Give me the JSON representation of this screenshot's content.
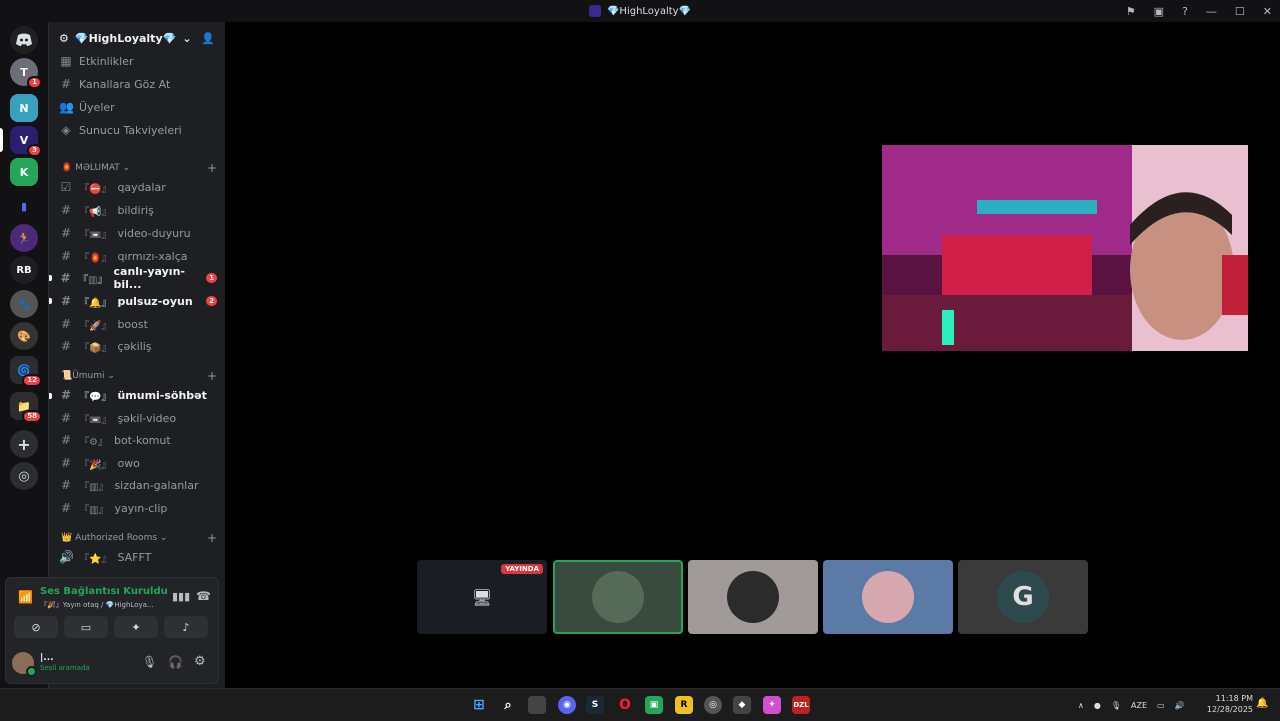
{
  "window": {
    "title": "💎HighLoyalty💎"
  },
  "guilds": {
    "items": [
      {
        "name": "discord-home-icon"
      },
      {
        "label": "T",
        "badge": "1"
      },
      {
        "label": "N"
      },
      {
        "label": "V",
        "badge": "3"
      },
      {
        "label": "K"
      },
      {
        "label": "▮"
      },
      {
        "label": "🏃"
      },
      {
        "label": "RB"
      },
      {
        "label": "🐾"
      },
      {
        "label": "🎨"
      },
      {
        "label": "🌀",
        "badge": "12"
      },
      {
        "label": "📁",
        "badge": "58"
      }
    ]
  },
  "server": {
    "name": "💎HighLoyalty💎",
    "chevron": "⌄",
    "menu": [
      {
        "icon": "calendar-icon",
        "label": "Etkinlikler"
      },
      {
        "icon": "browse-channels-icon",
        "label": "Kanallara Göz At"
      },
      {
        "icon": "members-icon",
        "label": "Üyeler"
      },
      {
        "icon": "boost-icon",
        "label": "Sunucu Takviyeleri"
      }
    ]
  },
  "categories": [
    {
      "label": "🏮 MƏLUMAT ⌄"
    },
    {
      "label": "📜Ümumi ⌄"
    },
    {
      "label": "👑 Authorized Rooms ⌄"
    }
  ],
  "channels": {
    "melumat": [
      {
        "prefix": "『⛔』",
        "name": "qaydalar",
        "icon": "☑"
      },
      {
        "prefix": "『📢』",
        "name": "bildiriş",
        "icon": "#"
      },
      {
        "prefix": "『📼』",
        "name": "video-duyuru",
        "icon": "#"
      },
      {
        "prefix": "『🏮』",
        "name": "qırmızı-xalça",
        "icon": "#"
      },
      {
        "prefix": "『▥』",
        "name": "canlı-yayın-bil...",
        "icon": "#",
        "count": "1"
      },
      {
        "prefix": "『🔔』",
        "name": "pulsuz-oyun",
        "icon": "#",
        "count": "2"
      },
      {
        "prefix": "『🚀』",
        "name": "boost",
        "icon": "#"
      },
      {
        "prefix": "『📦』",
        "name": "çəkiliş",
        "icon": "#"
      }
    ],
    "umumi": [
      {
        "prefix": "『💬』",
        "name": "ümumi-söhbət",
        "icon": "#"
      },
      {
        "prefix": "『📼』",
        "name": "şəkil-video",
        "icon": "#"
      },
      {
        "prefix": "『⚙』",
        "name": "bot-komut",
        "icon": "#"
      },
      {
        "prefix": "『🎉』",
        "name": "owo",
        "icon": "#"
      },
      {
        "prefix": "『▥』",
        "name": "sizdan-galanlar",
        "icon": "#"
      },
      {
        "prefix": "『▥』",
        "name": "yayın-clip",
        "icon": "#"
      }
    ],
    "authorized": [
      {
        "prefix": "『⭐』",
        "name": "SAFFT",
        "icon": "🔊"
      }
    ]
  },
  "voice": {
    "status": "Ses Bağlantısı Kuruldu",
    "channel": "『🎉』Yayın otaq / 💎HighLoya..."
  },
  "user": {
    "name": "|...",
    "status": "Sesli aramada"
  },
  "stage": {
    "live_label": "YAYINDA"
  },
  "taskbar": {
    "language": "AZE",
    "time": "11:18 PM",
    "date": "12/28/2025"
  },
  "colors": {
    "accent": "#5865f2",
    "online": "#23a55a",
    "danger": "#f23f43"
  }
}
